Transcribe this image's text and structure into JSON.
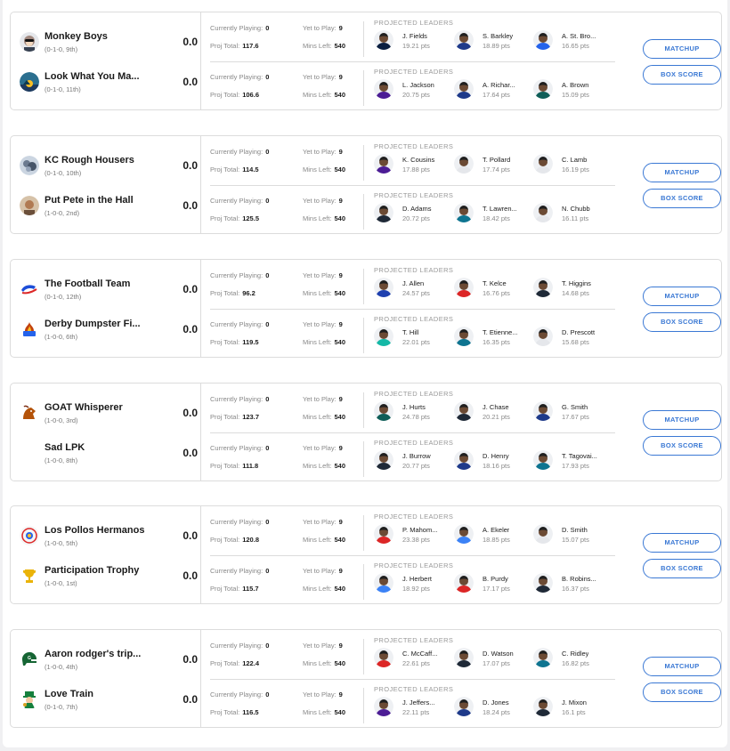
{
  "labels": {
    "currently_playing": "Currently Playing:",
    "yet_to_play": "Yet to Play:",
    "proj_total": "Proj Total:",
    "mins_left": "Mins Left:",
    "projected_leaders": "PROJECTED LEADERS",
    "matchup_button": "MATCHUP",
    "box_score_button": "BOX SCORE"
  },
  "matchups": [
    {
      "teams": [
        {
          "name": "Monkey Boys",
          "record": "(0-1-0, 9th)",
          "score": "0.0",
          "currently_playing": "0",
          "yet_to_play": "9",
          "proj_total": "117.6",
          "mins_left": "540",
          "logo_icon": "monkey-avatar-icon",
          "logo_color": "#8a9bb0",
          "leaders": [
            {
              "name": "J. Fields",
              "pts": "19.21 pts",
              "jersey": "#0b1f41"
            },
            {
              "name": "S. Barkley",
              "pts": "18.89 pts",
              "jersey": "#1e3a8a"
            },
            {
              "name": "A. St. Bro...",
              "pts": "16.65 pts",
              "jersey": "#2563eb"
            }
          ]
        },
        {
          "name": "Look What You Ma...",
          "record": "(0-1-0, 11th)",
          "score": "0.0",
          "currently_playing": "0",
          "yet_to_play": "9",
          "proj_total": "106.6",
          "mins_left": "540",
          "logo_icon": "sunset-logo-icon",
          "logo_color": "#2b6f8f",
          "leaders": [
            {
              "name": "L. Jackson",
              "pts": "20.75 pts",
              "jersey": "#4c1d95"
            },
            {
              "name": "A. Richar...",
              "pts": "17.64 pts",
              "jersey": "#1e3a8a"
            },
            {
              "name": "A. Brown",
              "pts": "15.09 pts",
              "jersey": "#0f5e58"
            }
          ]
        }
      ]
    },
    {
      "teams": [
        {
          "name": "KC Rough Housers",
          "record": "(0-1-0, 10th)",
          "score": "0.0",
          "currently_playing": "0",
          "yet_to_play": "9",
          "proj_total": "114.5",
          "mins_left": "540",
          "logo_icon": "rough-housers-logo-icon",
          "logo_color": "#6b7a8f",
          "leaders": [
            {
              "name": "K. Cousins",
              "pts": "17.88 pts",
              "jersey": "#4c1d95"
            },
            {
              "name": "T. Pollard",
              "pts": "17.74 pts",
              "jersey": "#e5e7eb"
            },
            {
              "name": "C. Lamb",
              "pts": "16.19 pts",
              "jersey": "#e5e7eb"
            }
          ]
        },
        {
          "name": "Put Pete in the Hall",
          "record": "(1-0-0, 2nd)",
          "score": "0.0",
          "currently_playing": "0",
          "yet_to_play": "9",
          "proj_total": "125.5",
          "mins_left": "540",
          "logo_icon": "pete-photo-icon",
          "logo_color": "#b07a52",
          "leaders": [
            {
              "name": "D. Adams",
              "pts": "20.72 pts",
              "jersey": "#1f2937"
            },
            {
              "name": "T. Lawren...",
              "pts": "18.42 pts",
              "jersey": "#0e7490"
            },
            {
              "name": "N. Chubb",
              "pts": "16.11 pts",
              "jersey": "#e5e7eb"
            }
          ]
        }
      ]
    },
    {
      "teams": [
        {
          "name": "The Football Team",
          "record": "(0-1-0, 12th)",
          "score": "0.0",
          "currently_playing": "0",
          "yet_to_play": "9",
          "proj_total": "96.2",
          "mins_left": "540",
          "logo_icon": "buffalo-logo-icon",
          "logo_color": "#1d4ed8",
          "leaders": [
            {
              "name": "J. Allen",
              "pts": "24.57 pts",
              "jersey": "#1e40af"
            },
            {
              "name": "T. Kelce",
              "pts": "16.76 pts",
              "jersey": "#dc2626"
            },
            {
              "name": "T. Higgins",
              "pts": "14.68 pts",
              "jersey": "#1f2937"
            }
          ]
        },
        {
          "name": "Derby Dumpster Fi...",
          "record": "(1-0-0, 6th)",
          "score": "0.0",
          "currently_playing": "0",
          "yet_to_play": "9",
          "proj_total": "119.5",
          "mins_left": "540",
          "logo_icon": "dumpster-fire-logo-icon",
          "logo_color": "#c2410c",
          "leaders": [
            {
              "name": "T. Hill",
              "pts": "22.01 pts",
              "jersey": "#14b8a6"
            },
            {
              "name": "T. Etienne...",
              "pts": "16.35 pts",
              "jersey": "#0e7490"
            },
            {
              "name": "D. Prescott",
              "pts": "15.68 pts",
              "jersey": "#e5e7eb"
            }
          ]
        }
      ]
    },
    {
      "teams": [
        {
          "name": "GOAT Whisperer",
          "record": "(1-0-0, 3rd)",
          "score": "0.0",
          "currently_playing": "0",
          "yet_to_play": "9",
          "proj_total": "123.7",
          "mins_left": "540",
          "logo_icon": "goat-logo-icon",
          "logo_color": "#b45309",
          "leaders": [
            {
              "name": "J. Hurts",
              "pts": "24.78 pts",
              "jersey": "#0f5e58"
            },
            {
              "name": "J. Chase",
              "pts": "20.21 pts",
              "jersey": "#1f2937"
            },
            {
              "name": "G. Smith",
              "pts": "17.67 pts",
              "jersey": "#1e3a8a"
            }
          ]
        },
        {
          "name": "Sad LPK",
          "record": "(1-0-0, 8th)",
          "score": "0.0",
          "currently_playing": "0",
          "yet_to_play": "9",
          "proj_total": "111.8",
          "mins_left": "540",
          "logo_icon": "blank-logo-icon",
          "logo_color": "#ffffff",
          "leaders": [
            {
              "name": "J. Burrow",
              "pts": "20.77 pts",
              "jersey": "#1f2937"
            },
            {
              "name": "D. Henry",
              "pts": "18.16 pts",
              "jersey": "#1e3a8a"
            },
            {
              "name": "T. Tagovai...",
              "pts": "17.93 pts",
              "jersey": "#0e7490"
            }
          ]
        }
      ]
    },
    {
      "teams": [
        {
          "name": "Los Pollos Hermanos",
          "record": "(1-0-0, 5th)",
          "score": "0.0",
          "currently_playing": "0",
          "yet_to_play": "9",
          "proj_total": "120.8",
          "mins_left": "540",
          "logo_icon": "pollos-logo-icon",
          "logo_color": "#dc2626",
          "leaders": [
            {
              "name": "P. Mahom...",
              "pts": "23.38 pts",
              "jersey": "#dc2626"
            },
            {
              "name": "A. Ekeler",
              "pts": "18.85 pts",
              "jersey": "#3b82f6"
            },
            {
              "name": "D. Smith",
              "pts": "15.07 pts",
              "jersey": "#e5e7eb"
            }
          ]
        },
        {
          "name": "Participation Trophy",
          "record": "(1-0-0, 1st)",
          "score": "0.0",
          "currently_playing": "0",
          "yet_to_play": "9",
          "proj_total": "115.7",
          "mins_left": "540",
          "logo_icon": "trophy-logo-icon",
          "logo_color": "#eab308",
          "leaders": [
            {
              "name": "J. Herbert",
              "pts": "18.92 pts",
              "jersey": "#3b82f6"
            },
            {
              "name": "B. Purdy",
              "pts": "17.17 pts",
              "jersey": "#dc2626"
            },
            {
              "name": "B. Robins...",
              "pts": "16.37 pts",
              "jersey": "#1f2937"
            }
          ]
        }
      ]
    },
    {
      "teams": [
        {
          "name": "Aaron rodger's trip...",
          "record": "(1-0-0, 4th)",
          "score": "0.0",
          "currently_playing": "0",
          "yet_to_play": "9",
          "proj_total": "122.4",
          "mins_left": "540",
          "logo_icon": "helmet-logo-icon",
          "logo_color": "#166534",
          "leaders": [
            {
              "name": "C. McCaff...",
              "pts": "22.61 pts",
              "jersey": "#dc2626"
            },
            {
              "name": "D. Watson",
              "pts": "17.07 pts",
              "jersey": "#1f2937"
            },
            {
              "name": "C. Ridley",
              "pts": "16.82 pts",
              "jersey": "#0e7490"
            }
          ]
        },
        {
          "name": "Love Train",
          "record": "(0-1-0, 7th)",
          "score": "0.0",
          "currently_playing": "0",
          "yet_to_play": "9",
          "proj_total": "116.5",
          "mins_left": "540",
          "logo_icon": "leprechaun-logo-icon",
          "logo_color": "#15803d",
          "leaders": [
            {
              "name": "J. Jeffers...",
              "pts": "22.11 pts",
              "jersey": "#4c1d95"
            },
            {
              "name": "D. Jones",
              "pts": "18.24 pts",
              "jersey": "#1e3a8a"
            },
            {
              "name": "J. Mixon",
              "pts": "16.1 pts",
              "jersey": "#1f2937"
            }
          ]
        }
      ]
    }
  ]
}
